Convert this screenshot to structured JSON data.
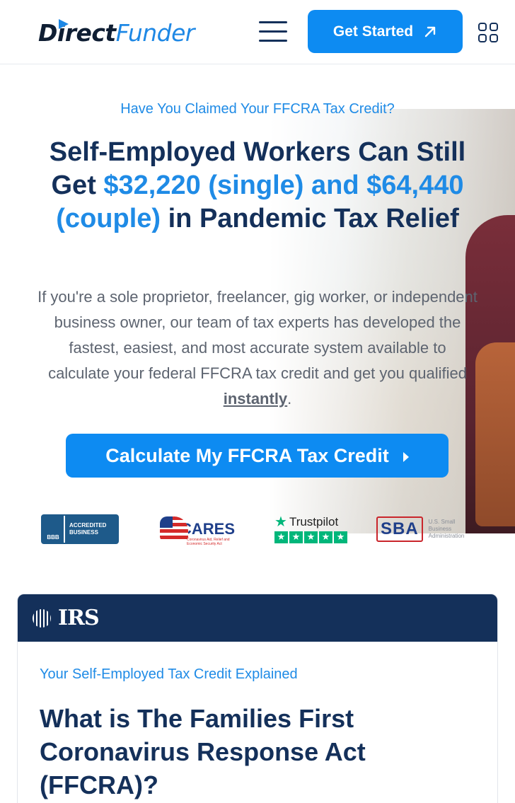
{
  "header": {
    "logo_direct": "Direct",
    "logo_funder": "Funder",
    "menu_icon": "hamburger-menu-icon",
    "get_started_label": "Get Started",
    "get_started_icon": "arrow-up-right-icon",
    "apps_icon": "grid-apps-icon"
  },
  "hero": {
    "eyebrow": "Have You Claimed Your FFCRA Tax Credit?",
    "headline_1": "Self-Employed Workers Can Still Get ",
    "headline_highlight": "$32,220 (single) and $64,440 (couple)",
    "headline_2": " in Pandemic Tax Relief",
    "lede_1": "If you're a sole proprietor, freelancer, gig worker, or independent business owner, our team of tax experts has developed the fastest, easiest, and most accurate system available to calculate your federal FFCRA tax credit and get you qualified ",
    "lede_em": "instantly",
    "lede_2": ".",
    "cta_label": "Calculate My FFCRA Tax Credit",
    "cta_icon": "caret-right-icon"
  },
  "badges": {
    "bbb_seal": "BBB",
    "bbb_text_1": "ACCREDITED",
    "bbb_text_2": "BUSINESS",
    "cares_word": "CARES",
    "cares_sub": "Coronavirus Aid, Relief and Economic Security Act",
    "trustpilot_word": "Trustpilot",
    "trustpilot_stars": 5,
    "sba_mark": "SBA",
    "sba_sub_1": "U.S. Small Business",
    "sba_sub_2": "Administration"
  },
  "card": {
    "irs_label": "IRS",
    "eyebrow": "Your Self-Employed Tax Credit Explained",
    "title": "What is The Families First Coronavirus Response Act (FFCRA)?"
  },
  "colors": {
    "brand_blue": "#0d8bf2",
    "accent_blue": "#1f8be6",
    "navy": "#14305a",
    "body_gray": "#5d6470",
    "trustpilot_green": "#00b67a"
  }
}
